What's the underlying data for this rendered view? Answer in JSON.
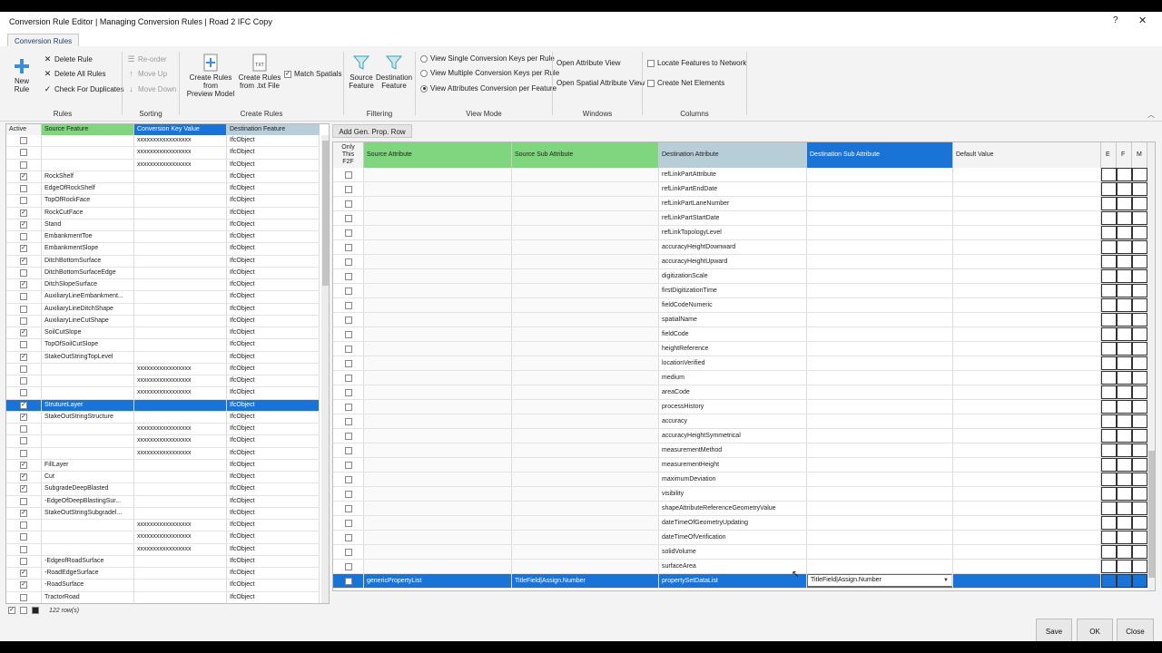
{
  "window": {
    "title": "Conversion Rule Editor | Managing Conversion Rules | Road 2 IFC Copy",
    "help": "?",
    "close": "✕"
  },
  "tab": "Conversion Rules",
  "ribbon": {
    "rules": {
      "label": "Rules",
      "new_rule": "New Rule",
      "delete_rule": "Delete Rule",
      "delete_all": "Delete All Rules",
      "check_dup": "Check For Duplicates"
    },
    "sorting": {
      "label": "Sorting",
      "reorder": "Re-order",
      "move_up": "Move Up",
      "move_down": "Move Down"
    },
    "create": {
      "label": "Create Rules",
      "from_preview_1": "Create Rules from",
      "from_preview_2": "Preview Model",
      "from_txt_1": "Create Rules",
      "from_txt_2": "from .txt File",
      "match_spatials": "Match Spatials"
    },
    "filtering": {
      "label": "Filtering",
      "source_1": "Source",
      "source_2": "Feature",
      "dest_1": "Destination",
      "dest_2": "Feature"
    },
    "viewmode": {
      "label": "View Mode",
      "single": "View Single Conversion Keys per Rule",
      "multiple": "View Multiple Conversion Keys per Rule",
      "attributes": "View Attributes Conversion per Feature"
    },
    "windows": {
      "label": "Windows",
      "attr_view": "Open Attribute View",
      "spatial_view": "Open Spatial Attribute View"
    },
    "columns": {
      "label": "Columns",
      "locate": "Locate Features to Network",
      "create_net": "Create Net Elements"
    }
  },
  "left": {
    "headers": [
      "Active",
      "Source Feature",
      "Conversion Key Value",
      "Destination Feature"
    ],
    "rows": [
      {
        "a": "",
        "s": "",
        "k": "xxxxxxxxxxxxxxxxx",
        "d": "IfcObject"
      },
      {
        "a": "",
        "s": "",
        "k": "xxxxxxxxxxxxxxxxx",
        "d": "IfcObject"
      },
      {
        "a": "",
        "s": "",
        "k": "xxxxxxxxxxxxxxxxx",
        "d": "IfcObject"
      },
      {
        "a": "✓",
        "s": "RockShelf",
        "k": "",
        "d": "IfcObject"
      },
      {
        "a": "",
        "s": "EdgeOfRockShelf",
        "k": "",
        "d": "IfcObject"
      },
      {
        "a": "",
        "s": "TopOfRockFace",
        "k": "",
        "d": "IfcObject"
      },
      {
        "a": "✓",
        "s": "RockCutFace",
        "k": "",
        "d": "IfcObject"
      },
      {
        "a": "✓",
        "s": "Stand",
        "k": "",
        "d": "IfcObject"
      },
      {
        "a": "",
        "s": "EmbankmentToe",
        "k": "",
        "d": "IfcObject"
      },
      {
        "a": "✓",
        "s": "EmbankmentSlope",
        "k": "",
        "d": "IfcObject"
      },
      {
        "a": "✓",
        "s": "DitchBottomSurface",
        "k": "",
        "d": "IfcObject"
      },
      {
        "a": "",
        "s": "DitchBottomSurfaceEdge",
        "k": "",
        "d": "IfcObject"
      },
      {
        "a": "✓",
        "s": "DitchSlopeSurface",
        "k": "",
        "d": "IfcObject"
      },
      {
        "a": "",
        "s": "AuxiliaryLineEmbankment...",
        "k": "",
        "d": "IfcObject"
      },
      {
        "a": "",
        "s": "AuxiliaryLineDitchShape",
        "k": "",
        "d": "IfcObject"
      },
      {
        "a": "",
        "s": "AuxiliaryLineCutShape",
        "k": "",
        "d": "IfcObject"
      },
      {
        "a": "✓",
        "s": "SoilCutSlope",
        "k": "",
        "d": "IfcObject"
      },
      {
        "a": "",
        "s": "TopOfSoilCutSlope",
        "k": "",
        "d": "IfcObject"
      },
      {
        "a": "✓",
        "s": "StakeOutStringTopLevel",
        "k": "",
        "d": "IfcObject"
      },
      {
        "a": "",
        "s": "",
        "k": "xxxxxxxxxxxxxxxxx",
        "d": "IfcObject"
      },
      {
        "a": "",
        "s": "",
        "k": "xxxxxxxxxxxxxxxxx",
        "d": "IfcObject"
      },
      {
        "a": "",
        "s": "",
        "k": "xxxxxxxxxxxxxxxxx",
        "d": "IfcObject"
      },
      {
        "a": "✓",
        "s": "StrutureLayer",
        "k": "",
        "d": "IfcObject",
        "sel": true
      },
      {
        "a": "✓",
        "s": "StakeOutStringStructure",
        "k": "",
        "d": "IfcObject"
      },
      {
        "a": "",
        "s": "",
        "k": "xxxxxxxxxxxxxxxxx",
        "d": "IfcObject"
      },
      {
        "a": "",
        "s": "",
        "k": "xxxxxxxxxxxxxxxxx",
        "d": "IfcObject"
      },
      {
        "a": "",
        "s": "",
        "k": "xxxxxxxxxxxxxxxxx",
        "d": "IfcObject"
      },
      {
        "a": "✓",
        "s": "FillLayer",
        "k": "",
        "d": "IfcObject"
      },
      {
        "a": "✓",
        "s": "Cut",
        "k": "",
        "d": "IfcObject"
      },
      {
        "a": "✓",
        "s": "SubgradeDeepBlasted",
        "k": "",
        "d": "IfcObject"
      },
      {
        "a": "",
        "s": "-EdgeOfDeepBlastingSur...",
        "k": "",
        "d": "IfcObject"
      },
      {
        "a": "✓",
        "s": "StakeOutStringSubgradel...",
        "k": "",
        "d": "IfcObject"
      },
      {
        "a": "",
        "s": "",
        "k": "xxxxxxxxxxxxxxxxx",
        "d": "IfcObject"
      },
      {
        "a": "",
        "s": "",
        "k": "xxxxxxxxxxxxxxxxx",
        "d": "IfcObject"
      },
      {
        "a": "",
        "s": "",
        "k": "xxxxxxxxxxxxxxxxx",
        "d": "IfcObject"
      },
      {
        "a": "",
        "s": "-EdgeofRoadSurface",
        "k": "",
        "d": "IfcObject"
      },
      {
        "a": "✓",
        "s": "-RoadEdgeSurface",
        "k": "",
        "d": "IfcObject"
      },
      {
        "a": "✓",
        "s": "-RoadSurface",
        "k": "",
        "d": "IfcObject"
      },
      {
        "a": "",
        "s": "TractorRoad",
        "k": "",
        "d": "IfcObject"
      }
    ],
    "row_count": "122 row(s)"
  },
  "add_gen_prop": "Add Gen. Prop. Row",
  "right": {
    "headers": {
      "only": "Only This F2F",
      "src": "Source Attribute",
      "srcsub": "Source Sub Attribute",
      "dst": "Destination Attribute",
      "dstsub": "Destination Sub Attribute",
      "def": "Default Value",
      "e": "E",
      "f": "F",
      "m": "M"
    },
    "rows": [
      {
        "d": "refLinkPartAttribute"
      },
      {
        "d": "refLinkPartEndDate"
      },
      {
        "d": "refLinkPartLaneNumber"
      },
      {
        "d": "refLinkPartStartDate"
      },
      {
        "d": "refLinkTopologyLevel"
      },
      {
        "d": "accuracyHeightDownward"
      },
      {
        "d": "accuracyHeightUpward"
      },
      {
        "d": "digitizationScale"
      },
      {
        "d": "firstDigitizationTime"
      },
      {
        "d": "fieldCodeNumeric"
      },
      {
        "d": "spatialName"
      },
      {
        "d": "fieldCode"
      },
      {
        "d": "heightReference"
      },
      {
        "d": "locationVerified"
      },
      {
        "d": "medium"
      },
      {
        "d": "areaCode"
      },
      {
        "d": "processHistory"
      },
      {
        "d": "accuracy"
      },
      {
        "d": "accuracyHeightSymmetrical"
      },
      {
        "d": "measurementMethod"
      },
      {
        "d": "measurementHeight"
      },
      {
        "d": "maximumDeviation"
      },
      {
        "d": "visibility"
      },
      {
        "d": "shapeAttributeReferenceGeometryValue"
      },
      {
        "d": "dateTimeOfGeometryUpdating"
      },
      {
        "d": "dateTimeOfVerification"
      },
      {
        "d": "solidVolume"
      },
      {
        "d": "surfaceArea"
      }
    ],
    "selected": {
      "src": "genericPropertyList",
      "srcsub": "TitleField|Assign.Number",
      "dst": "propertySetDataList",
      "dstsub": "TitleField|Assign.Number"
    }
  },
  "buttons": {
    "save": "Save",
    "ok": "OK",
    "close": "Close"
  }
}
